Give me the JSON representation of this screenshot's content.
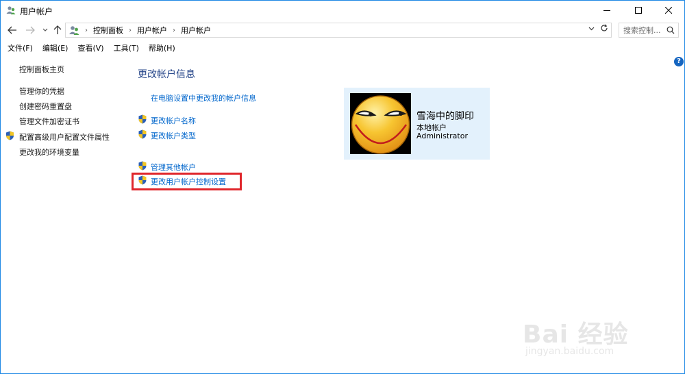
{
  "window": {
    "title": "用户帐户",
    "minimize_icon": "minimize-icon",
    "maximize_icon": "maximize-icon",
    "close_icon": "close-icon"
  },
  "nav": {
    "back_icon": "arrow-left-icon",
    "forward_icon": "arrow-right-icon",
    "recent_icon": "chevron-down-icon",
    "up_icon": "arrow-up-icon",
    "breadcrumb": [
      "控制面板",
      "用户帐户",
      "用户帐户"
    ],
    "search_placeholder": "搜索控制...",
    "refresh_icon": "refresh-icon"
  },
  "menu": [
    "文件(F)",
    "编辑(E)",
    "查看(V)",
    "工具(T)",
    "帮助(H)"
  ],
  "sidebar": {
    "home": "控制面板主页",
    "items": [
      {
        "label": "管理你的凭据",
        "shield": false
      },
      {
        "label": "创建密码重置盘",
        "shield": false
      },
      {
        "label": "管理文件加密证书",
        "shield": false
      },
      {
        "label": "配置高级用户配置文件属性",
        "shield": true
      },
      {
        "label": "更改我的环境变量",
        "shield": false
      }
    ]
  },
  "main": {
    "title": "更改帐户信息",
    "pc_settings_link": "在电脑设置中更改我的帐户信息",
    "links": [
      {
        "label": "更改帐户名称",
        "shield": true
      },
      {
        "label": "更改帐户类型",
        "shield": true
      },
      {
        "label": "管理其他帐户",
        "shield": true
      },
      {
        "label": "更改用户帐户控制设置",
        "shield": true,
        "highlighted": true
      }
    ]
  },
  "account": {
    "name": "雪海中的脚印",
    "type": "本地帐户",
    "role": "Administrator"
  },
  "watermark": {
    "text": "Bai 经验",
    "url": "jingyan.baidu.com"
  },
  "colors": {
    "accent": "#1e88e5",
    "link": "#0066cc",
    "title": "#1e3f85",
    "card_bg": "#e3f1fc",
    "highlight": "#e0262b"
  }
}
